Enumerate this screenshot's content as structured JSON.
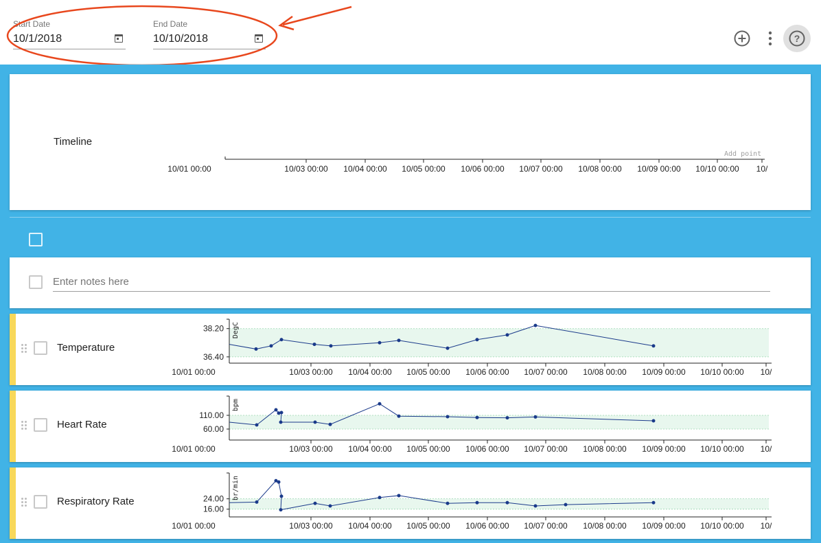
{
  "header": {
    "start_date": {
      "label": "Start Date",
      "value": "10/1/2018"
    },
    "end_date": {
      "label": "End Date",
      "value": "10/10/2018"
    },
    "icons": {
      "add": "add-circle-icon",
      "more": "more-vert-icon",
      "help": "help-circle-icon"
    }
  },
  "timeline": {
    "title": "Timeline",
    "add_point_label": "Add point",
    "ticks": [
      "10/01 00:00",
      "10/03 00:00",
      "10/04 00:00",
      "10/05 00:00",
      "10/06 00:00",
      "10/07 00:00",
      "10/08 00:00",
      "10/09 00:00",
      "10/10 00:00",
      "10/"
    ]
  },
  "notes": {
    "placeholder": "Enter notes here"
  },
  "colors": {
    "canvas": "#41b3e6",
    "accent_bar": "#f8d85a",
    "series": "#1a3a8a",
    "normal_band": "#e8f7ee",
    "annotation": "#e8471d"
  },
  "chart_data": [
    {
      "type": "line",
      "title": "Temperature",
      "ylabel": "DegC",
      "x_ticks": [
        "10/01 00:00",
        "10/03 00:00",
        "10/04 00:00",
        "10/05 00:00",
        "10/06 00:00",
        "10/07 00:00",
        "10/08 00:00",
        "10/09 00:00",
        "10/10 00:00",
        "10/"
      ],
      "y_ticks": [
        "38.20",
        "36.40"
      ],
      "normal_range": [
        36.4,
        38.2
      ],
      "ylim": [
        36.0,
        38.8
      ],
      "xlim_days": [
        0,
        9.3
      ],
      "x_days": [
        0.0,
        0.45,
        0.72,
        0.9,
        1.62,
        1.85,
        2.6,
        2.92,
        3.7,
        4.25,
        4.7,
        5.3
      ],
      "values": [
        37.2,
        36.9,
        37.1,
        37.5,
        37.2,
        37.1,
        37.3,
        37.45,
        36.95,
        37.5,
        37.8,
        38.4,
        37.1
      ]
    },
    {
      "type": "line",
      "title": "Heart Rate",
      "ylabel": "bpm",
      "x_ticks": [
        "10/01 00:00",
        "10/03 00:00",
        "10/04 00:00",
        "10/05 00:00",
        "10/06 00:00",
        "10/07 00:00",
        "10/08 00:00",
        "10/09 00:00",
        "10/10 00:00",
        "10/"
      ],
      "y_ticks": [
        "110.00",
        "60.00"
      ],
      "normal_range": [
        60,
        110
      ],
      "ylim": [
        20,
        180
      ],
      "values": [
        85,
        75,
        130,
        118,
        120,
        85,
        85,
        77,
        152,
        107,
        105,
        102,
        101,
        104,
        90
      ]
    },
    {
      "type": "line",
      "title": "Respiratory Rate",
      "ylabel": "br/min",
      "x_ticks": [
        "10/01 00:00",
        "10/03 00:00",
        "10/04 00:00",
        "10/05 00:00",
        "10/06 00:00",
        "10/07 00:00",
        "10/08 00:00",
        "10/09 00:00",
        "10/10 00:00",
        "10/"
      ],
      "y_ticks": [
        "24.00",
        "16.00"
      ],
      "normal_range": [
        16,
        24
      ],
      "ylim": [
        10,
        44
      ],
      "values": [
        21,
        21.5,
        38,
        37,
        26,
        15.5,
        20.5,
        18.5,
        25,
        26.5,
        20.5,
        21,
        21,
        18.5,
        19.5,
        21
      ]
    }
  ]
}
